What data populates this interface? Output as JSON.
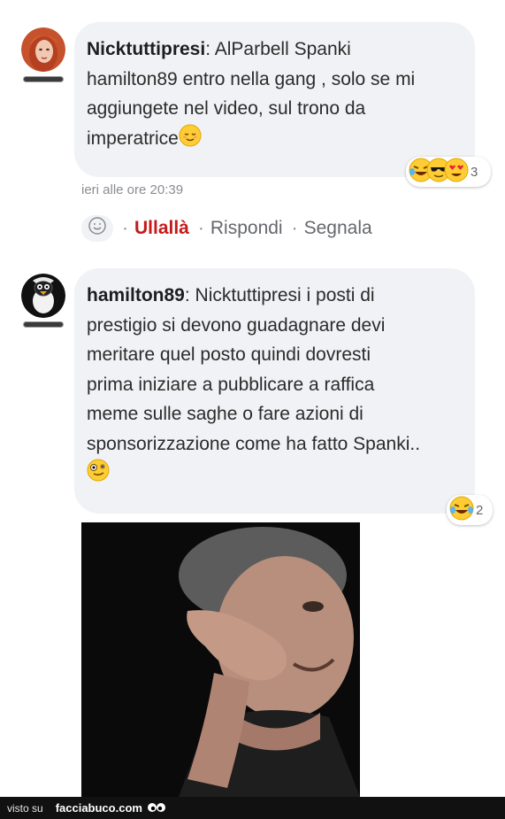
{
  "comments": [
    {
      "author": "Nicktuttipresi",
      "text_lines": [
        "AlParbell Spanki",
        "hamilton89 entro nella gang , solo se mi",
        "aggiungete nel video, sul trono da",
        "imperatrice"
      ],
      "end_emoji": "relieved-face-icon",
      "reactions": [
        "laughing-crying-icon",
        "sunglasses-icon",
        "heart-eyes-icon"
      ],
      "reaction_count": "3",
      "timestamp": "ieri alle ore 20:39",
      "actions": {
        "like": "Ullallà",
        "reply": "Rispondi",
        "report": "Segnala"
      }
    },
    {
      "author": "hamilton89",
      "text_lines": [
        "Nicktuttipresi i posti di",
        "prestigio si devono guadagnare devi",
        "meritare quel posto quindi dovresti",
        "prima iniziare a pubblicare a raffica",
        "meme sulle saghe o fare azioni di",
        "sponsorizzazione come ha fatto Spanki.."
      ],
      "end_emoji": "zany-face-icon",
      "reactions": [
        "laughing-crying-icon"
      ],
      "reaction_count": "2"
    }
  ],
  "footer": {
    "visto_su": "visto su",
    "site": "facciabuco.com"
  },
  "colors": {
    "bubble": "#f0f2f5",
    "like": "#c41a1a",
    "muted": "#65676b"
  }
}
